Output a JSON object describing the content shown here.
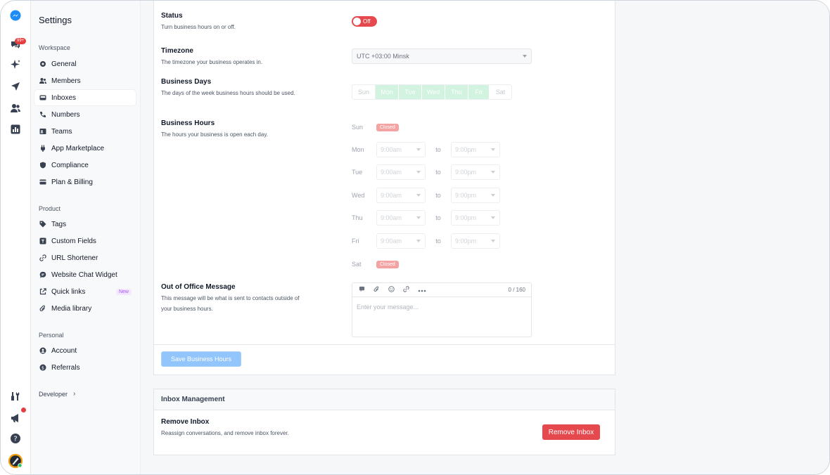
{
  "sidebar": {
    "title": "Settings",
    "sections": {
      "workspace": "Workspace",
      "product": "Product",
      "personal": "Personal"
    },
    "workspace_items": [
      {
        "label": "General",
        "icon": "gear-icon"
      },
      {
        "label": "Members",
        "icon": "users-icon"
      },
      {
        "label": "Inboxes",
        "icon": "inbox-icon"
      },
      {
        "label": "Numbers",
        "icon": "phone-icon"
      },
      {
        "label": "Teams",
        "icon": "id-card-icon"
      },
      {
        "label": "App Marketplace",
        "icon": "plug-icon"
      },
      {
        "label": "Compliance",
        "icon": "shield-icon"
      },
      {
        "label": "Plan & Billing",
        "icon": "credit-card-icon"
      }
    ],
    "product_items": [
      {
        "label": "Tags",
        "icon": "tag-icon"
      },
      {
        "label": "Custom Fields",
        "icon": "text-field-icon"
      },
      {
        "label": "URL Shortener",
        "icon": "link-icon"
      },
      {
        "label": "Website Chat Widget",
        "icon": "chat-bubble-icon"
      },
      {
        "label": "Quick links",
        "icon": "external-link-icon",
        "badge": "New"
      },
      {
        "label": "Media library",
        "icon": "paperclip-icon"
      }
    ],
    "personal_items": [
      {
        "label": "Account",
        "icon": "user-circle-icon"
      },
      {
        "label": "Referrals",
        "icon": "dollar-icon"
      }
    ],
    "developer": "Developer",
    "rail_badge": "99+"
  },
  "business_hours": {
    "status": {
      "label": "Status",
      "desc": "Turn business hours on or off.",
      "toggle": "Off"
    },
    "timezone": {
      "label": "Timezone",
      "desc": "The timezone your business operates in.",
      "value": "UTC +03:00 Minsk"
    },
    "days": {
      "label": "Business Days",
      "desc": "The days of the week business hours should be used.",
      "items": [
        "Sun",
        "Mon",
        "Tue",
        "Wed",
        "Thu",
        "Fri",
        "Sat"
      ]
    },
    "hours": {
      "label": "Business Hours",
      "desc": "The hours your business is open each day.",
      "closed_label": "Closed",
      "to_label": "to",
      "rows": [
        {
          "day": "Sun",
          "closed": true
        },
        {
          "day": "Mon",
          "open": "9:00am",
          "close": "9:00pm"
        },
        {
          "day": "Tue",
          "open": "9:00am",
          "close": "9:00pm"
        },
        {
          "day": "Wed",
          "open": "9:00am",
          "close": "9:00pm"
        },
        {
          "day": "Thu",
          "open": "9:00am",
          "close": "9:00pm"
        },
        {
          "day": "Fri",
          "open": "9:00am",
          "close": "9:00pm"
        },
        {
          "day": "Sat",
          "closed": true
        }
      ]
    },
    "ooo": {
      "label": "Out of Office Message",
      "desc": "This message will be what is sent to contacts outside of your business hours.",
      "counter": "0 / 160",
      "placeholder": "Enter your message..."
    },
    "save_label": "Save Business Hours"
  },
  "inbox_management": {
    "title": "Inbox Management",
    "remove": {
      "label": "Remove Inbox",
      "desc": "Reassign conversations, and remove inbox forever.",
      "button": "Remove Inbox"
    }
  },
  "colors": {
    "accent_blue": "#93c5fd",
    "danger": "#e5484d",
    "day_selected": "#d1f3df"
  }
}
